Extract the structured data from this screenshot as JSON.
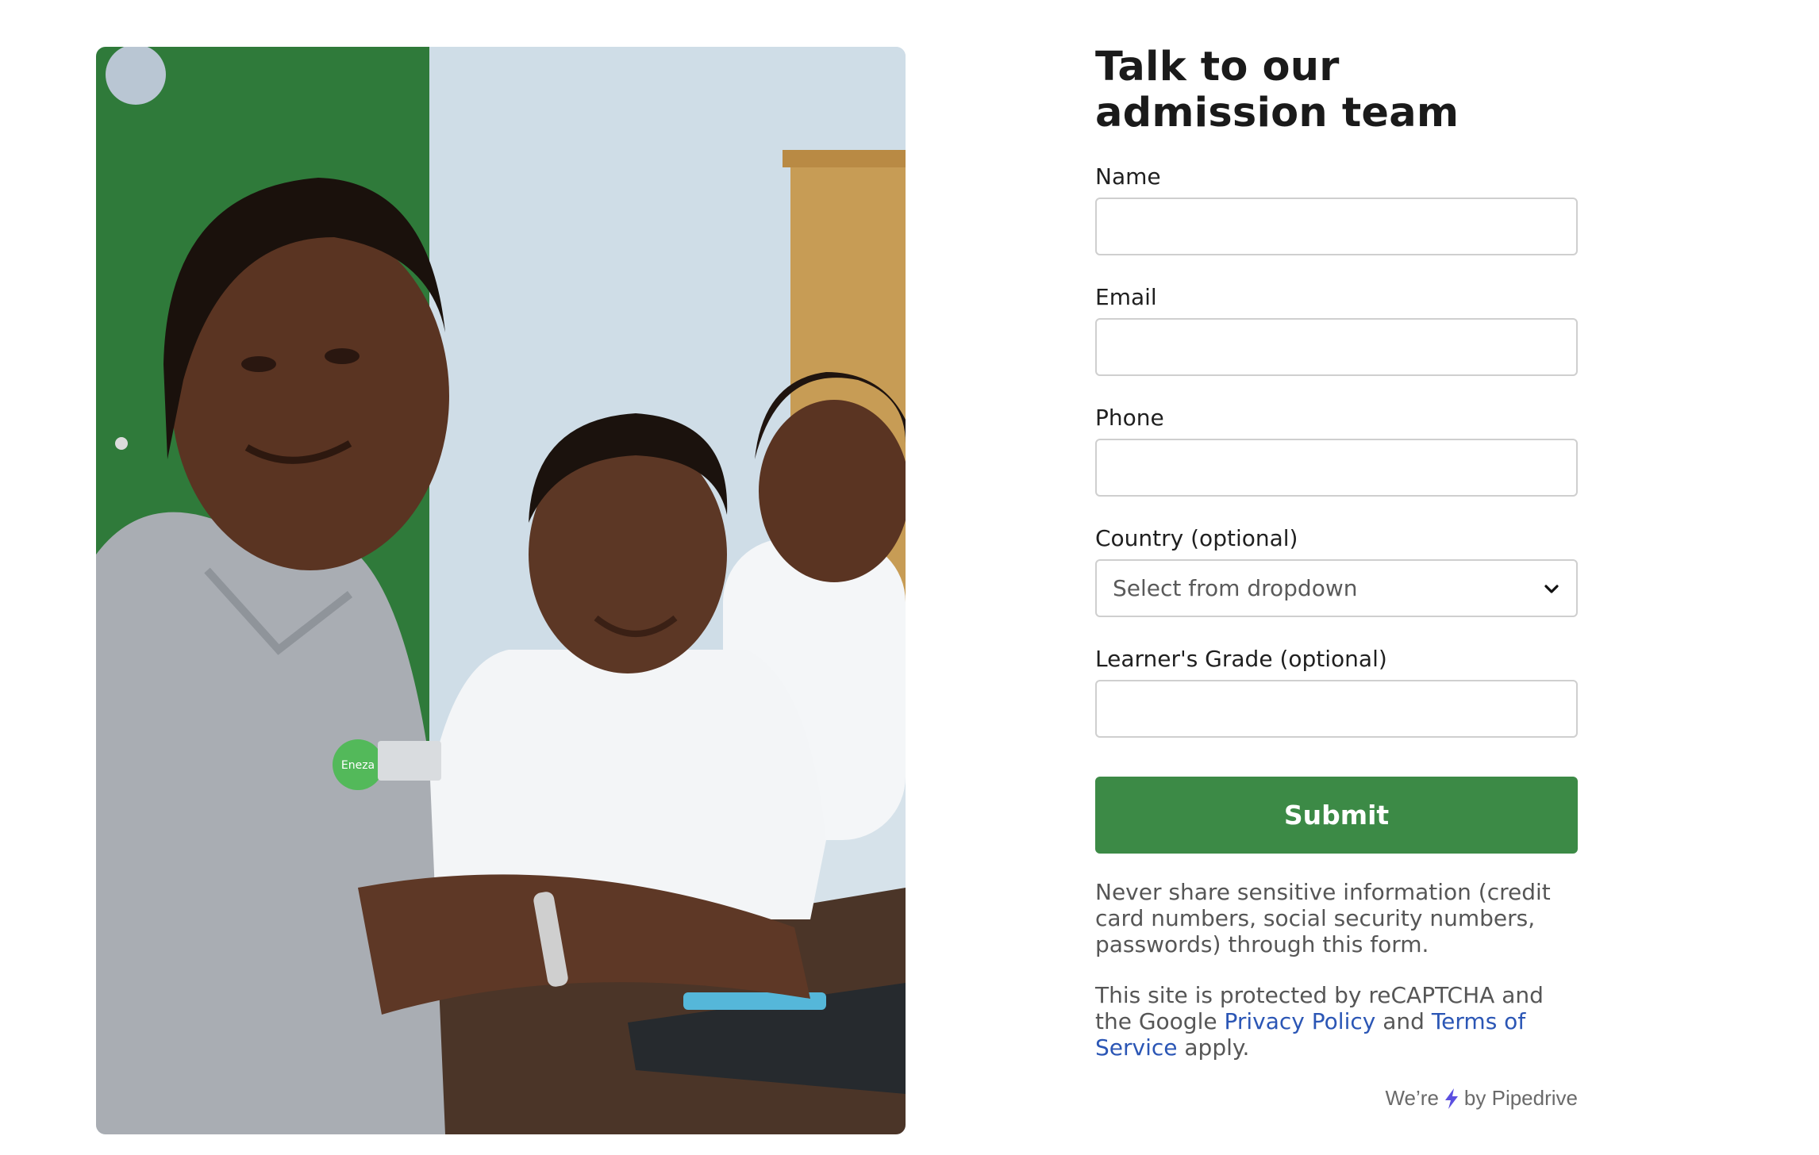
{
  "form": {
    "title": "Talk to our admission team",
    "fields": {
      "name": {
        "label": "Name",
        "value": ""
      },
      "email": {
        "label": "Email",
        "value": ""
      },
      "phone": {
        "label": "Phone",
        "value": ""
      },
      "country": {
        "label": "Country (optional)",
        "selected": "Select from dropdown"
      },
      "grade": {
        "label": "Learner's Grade (optional)",
        "value": ""
      }
    },
    "submit_label": "Submit",
    "warning": "Never share sensitive information (credit card numbers, social security numbers, passwords) through this form.",
    "recaptcha": {
      "prefix": "This site is protected by reCAPTCHA and the Google",
      "privacy_link": "Privacy Policy",
      "and": "and",
      "terms_link": "Terms of Service",
      "suffix": "apply."
    },
    "powered_by": {
      "prefix": "We’re",
      "suffix": "by Pipedrive",
      "icon": "lightning-icon"
    }
  },
  "photo": {
    "badge_text": "Eneza"
  },
  "colors": {
    "submit": "#3c8a46",
    "link": "#2b56b5",
    "bolt": "#5b4fe0"
  }
}
